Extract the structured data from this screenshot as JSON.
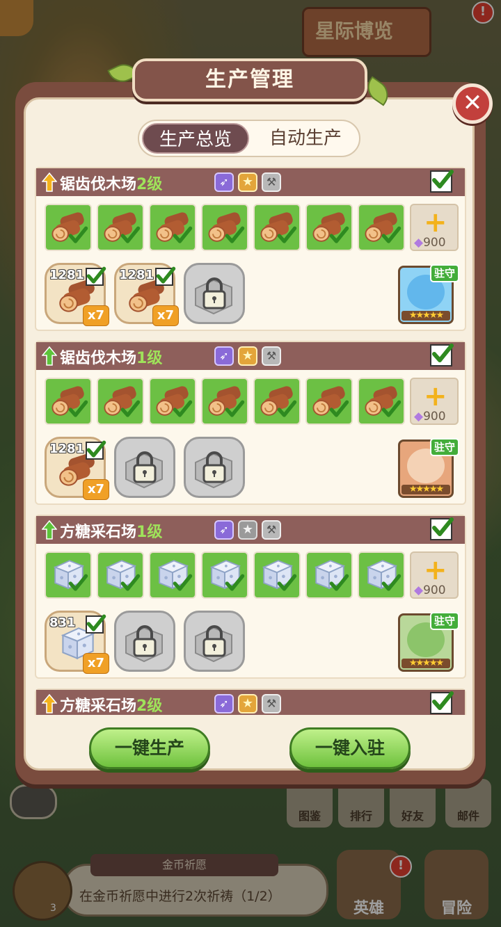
{
  "dialog": {
    "title": "生产管理",
    "close_icon": "close-icon"
  },
  "tabs": [
    {
      "label": "生产总览",
      "active": true
    },
    {
      "label": "自动生产",
      "active": false
    }
  ],
  "buildings": [
    {
      "name": "锯齿伐木场",
      "level": "2级",
      "upgrade_arrow": "orange",
      "star_badge": "gold",
      "resource": "wood",
      "slot_cost": "900",
      "outputs": [
        {
          "count": "1281",
          "multiplier": "x7"
        },
        {
          "count": "1281",
          "multiplier": "x7"
        }
      ],
      "locked_slots": 1,
      "guard_label": "驻守",
      "hero": "blue-hair"
    },
    {
      "name": "锯齿伐木场",
      "level": "1级",
      "upgrade_arrow": "green",
      "star_badge": "gold",
      "resource": "wood",
      "slot_cost": "900",
      "outputs": [
        {
          "count": "1281",
          "multiplier": "x7"
        }
      ],
      "locked_slots": 2,
      "guard_label": "驻守",
      "hero": "glasses-boy"
    },
    {
      "name": "方糖采石场",
      "level": "1级",
      "upgrade_arrow": "green",
      "star_badge": "gray",
      "resource": "sugar-cube",
      "slot_cost": "900",
      "outputs": [
        {
          "count": "831",
          "multiplier": "x7"
        }
      ],
      "locked_slots": 2,
      "guard_label": "驻守",
      "hero": "green-hair"
    },
    {
      "name": "方糖采石场",
      "level": "2级",
      "upgrade_arrow": "orange",
      "star_badge": "gold",
      "resource": "sugar-cube"
    }
  ],
  "buttons": {
    "produce_all": "一键生产",
    "station_all": "一键入驻"
  },
  "background": {
    "event_banner": "星际博览",
    "nav": [
      "图鉴",
      "排行",
      "好友",
      "邮件"
    ],
    "wish_title": "金币祈愿",
    "wish_task": "在金币祈愿中进行2次祈祷（1/2）",
    "coin_badge": "3",
    "hero_button": "英雄",
    "adventure_button": "冒险",
    "alert": "!"
  },
  "colors": {
    "header_bg": "#8e5f5b",
    "slot_green": "#6cc044",
    "level_text": "#9fe35a",
    "button_green": "#6fc23e",
    "close_red": "#c2403c"
  }
}
